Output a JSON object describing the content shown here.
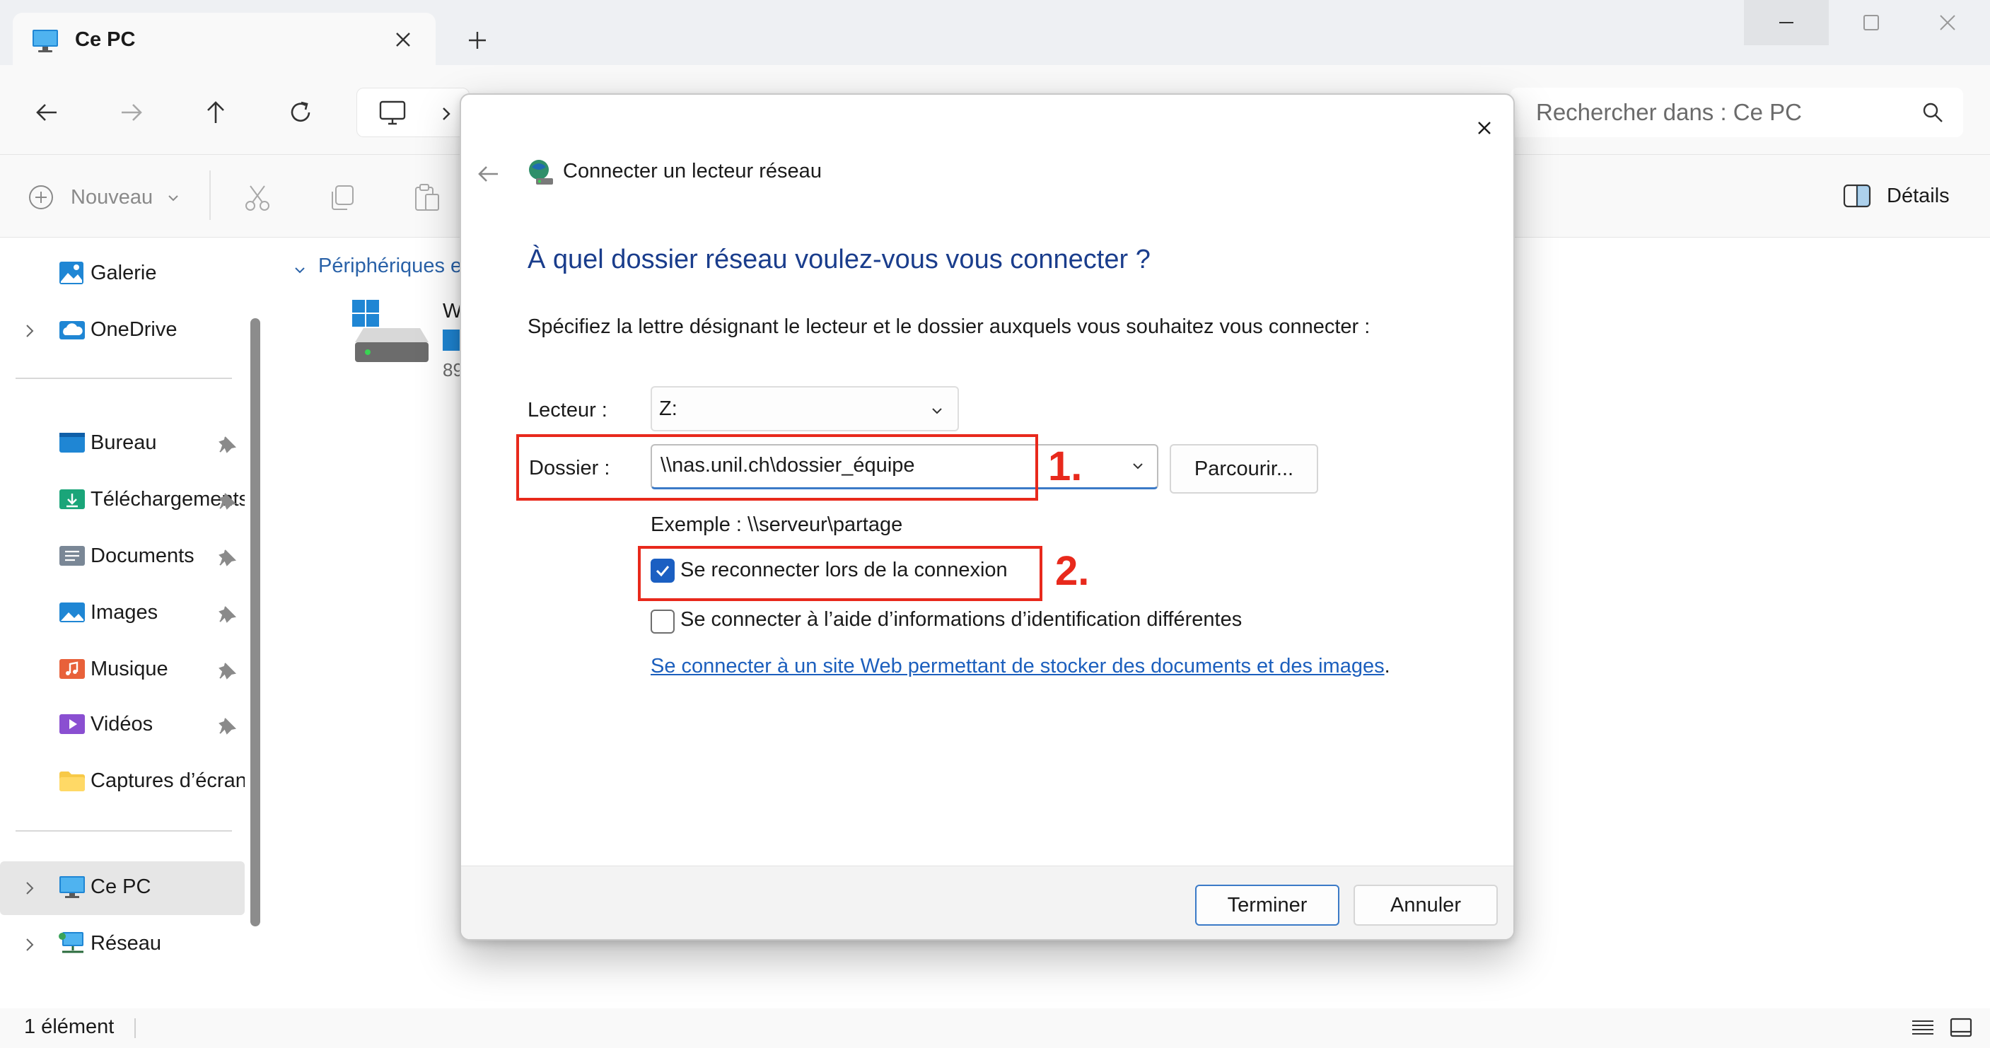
{
  "window": {
    "tab_title": "Ce PC",
    "search_placeholder": "Rechercher dans : Ce PC"
  },
  "toolbar": {
    "new_label": "Nouveau",
    "details_label": "Détails"
  },
  "sidebar": {
    "items": [
      {
        "label": "Galerie",
        "icon": "gallery-icon"
      },
      {
        "label": "OneDrive",
        "icon": "cloud-icon"
      },
      {
        "label": "Bureau",
        "icon": "desktop-folder-icon"
      },
      {
        "label": "Téléchargements",
        "icon": "downloads-folder-icon"
      },
      {
        "label": "Documents",
        "icon": "documents-folder-icon"
      },
      {
        "label": "Images",
        "icon": "pictures-folder-icon"
      },
      {
        "label": "Musique",
        "icon": "music-folder-icon"
      },
      {
        "label": "Vidéos",
        "icon": "videos-folder-icon"
      },
      {
        "label": "Captures d’écran",
        "icon": "folder-icon"
      },
      {
        "label": "Ce PC",
        "icon": "pc-icon"
      },
      {
        "label": "Réseau",
        "icon": "network-icon"
      }
    ]
  },
  "content": {
    "group_header": "Périphériques et lecteurs",
    "drive_label": "W",
    "drive_free": "89"
  },
  "statusbar": {
    "count": "1 élément"
  },
  "dialog": {
    "title": "Connecter un lecteur réseau",
    "heading": "À quel dossier réseau voulez-vous vous connecter ?",
    "instruction": "Spécifiez la lettre désignant le lecteur et le dossier auxquels vous souhaitez vous connecter :",
    "drive_letter_label": "Lecteur :",
    "drive_letter_value": "Z:",
    "folder_label": "Dossier :",
    "folder_value": "\\\\nas.unil.ch\\dossier_équipe",
    "browse_label": "Parcourir...",
    "example": "Exemple : \\\\serveur\\partage",
    "reconnect_label": "Se reconnecter lors de la connexion",
    "reconnect_checked": true,
    "credentials_label": "Se connecter à l’aide d’informations d’identification différentes",
    "credentials_checked": false,
    "website_link": "Se connecter à un site Web permettant de stocker des documents et des images",
    "website_link_suffix": ".",
    "finish_label": "Terminer",
    "cancel_label": "Annuler"
  },
  "annotations": {
    "step1": "1.",
    "step2": "2."
  },
  "colors": {
    "accent": "#1b5fc2",
    "heading": "#1a3d8c",
    "link": "#1c5fbd",
    "callout": "#e8291c"
  }
}
